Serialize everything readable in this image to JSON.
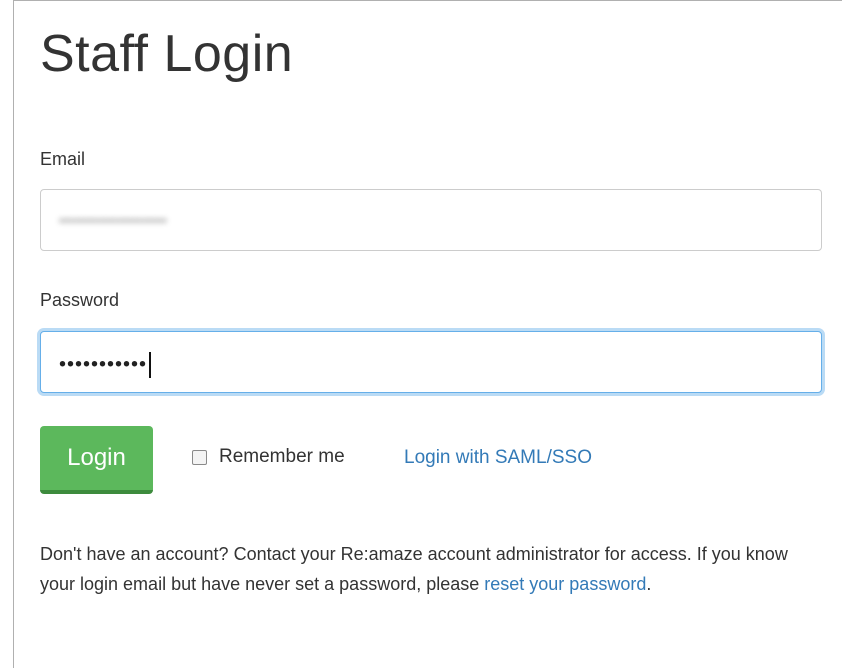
{
  "page": {
    "title": "Staff Login"
  },
  "form": {
    "email_label": "Email",
    "email_value": "••••••••••••••••••••••",
    "password_label": "Password",
    "password_value": "•••••••••••",
    "login_button": "Login",
    "remember_me_label": "Remember me",
    "remember_me_checked": false,
    "saml_link": "Login with SAML/SSO"
  },
  "help": {
    "text": "Don't have an account? Contact your Re:amaze account administrator for access. If you know your login email but have never set a password, please ",
    "reset_link": "reset your password",
    "suffix": "."
  },
  "colors": {
    "primary_button": "#5cb85c",
    "link": "#337ab7",
    "focus_ring": "#66afe9"
  }
}
